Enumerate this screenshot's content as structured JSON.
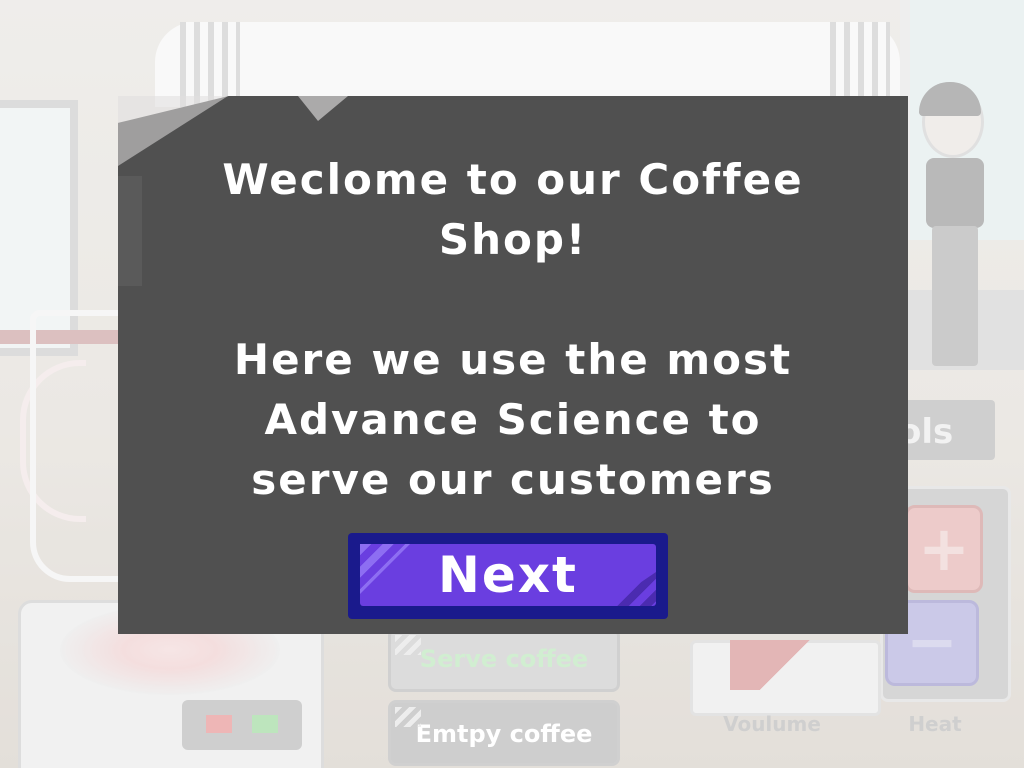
{
  "scene": {
    "tools_label_partial": "ols",
    "volume_label": "Voulume",
    "heat_label": "Heat",
    "plus_symbol": "+",
    "minus_symbol": "−",
    "serve_button_label": "Serve coffee",
    "empty_button_label": "Emtpy coffee"
  },
  "dialog": {
    "title_line1": "Weclome to our Coffee",
    "title_line2": "Shop!",
    "body_line1": "Here we use the most",
    "body_line2": "Advance Science to",
    "body_line3": "serve our customers",
    "next_label": "Next"
  },
  "colors": {
    "dialog_bg": "#505050",
    "next_button_border": "#1a1a8c",
    "next_button_fill": "#6a3ee0",
    "serve_text": "#bfe8bf"
  }
}
